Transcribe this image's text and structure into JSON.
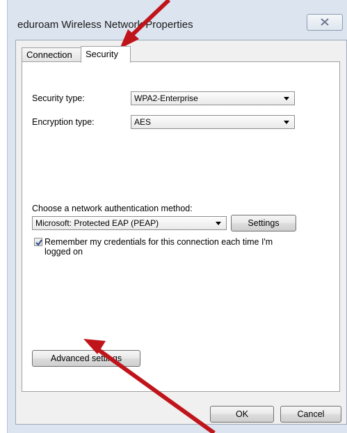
{
  "window": {
    "title": "eduroam Wireless Network Properties",
    "close_glyph": "☒"
  },
  "tabs": [
    {
      "label": "Connection",
      "selected": false
    },
    {
      "label": "Security",
      "selected": true
    }
  ],
  "security_tab": {
    "security_type_label": "Security type:",
    "security_type_value": "WPA2-Enterprise",
    "encryption_type_label": "Encryption type:",
    "encryption_type_value": "AES",
    "auth_method_label": "Choose a network authentication method:",
    "auth_method_value": "Microsoft: Protected EAP (PEAP)",
    "settings_button": "Settings",
    "remember_checked": true,
    "remember_label": "Remember my credentials for this connection each time I'm logged on",
    "advanced_button": "Advanced settings"
  },
  "footer": {
    "ok_button": "OK",
    "cancel_button": "Cancel"
  },
  "annotations": {
    "arrow_color": "#c0141b"
  }
}
